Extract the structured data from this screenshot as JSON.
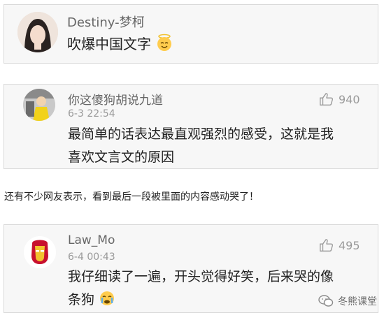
{
  "comments": [
    {
      "name": "Destiny-梦柯",
      "text": "吹爆中国文字",
      "emoji": "angel-face-icon"
    },
    {
      "name": "你这傻狗胡说九道",
      "time": "6-3 22:54",
      "likes": "940",
      "line1": "最简单的话表达最直观强烈的感受，这就是我",
      "line2": "喜欢文言文的原因"
    },
    {
      "name": "Law_Mo",
      "time": "6-4 00:43",
      "likes": "495",
      "line1": "我仔细读了一遍，开头觉得好笑，后来哭的像",
      "line2": "条狗",
      "emoji": "crying-face-icon"
    }
  ],
  "between_text": "还有不少网友表示，看到最后一段被里面的内容感动哭了！",
  "watermark": "冬熊课堂",
  "colors": {
    "card_bg": "#f7f7f7",
    "border": "#d9d9d9",
    "name": "#666666",
    "meta": "#9a9a9a",
    "text": "#222222"
  }
}
